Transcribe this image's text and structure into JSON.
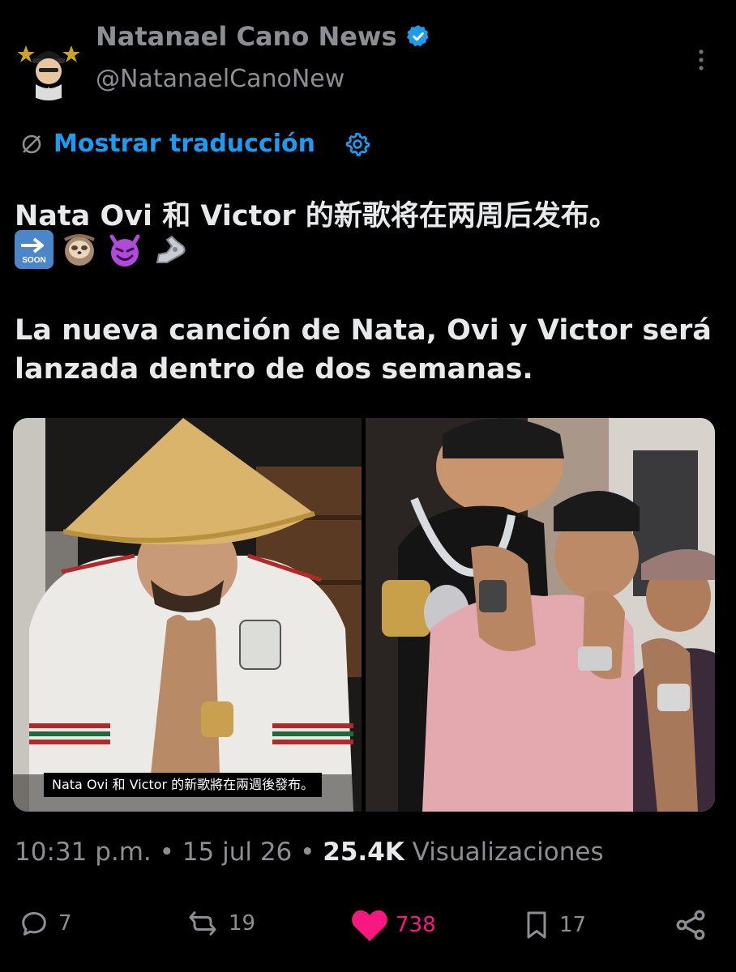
{
  "author": {
    "name": "Natanael Cano News",
    "handle": "@NatanaelCanoNew",
    "verified": true
  },
  "translate": {
    "label": "Mostrar traducción"
  },
  "tweet": {
    "line_zh": "Nata Ovi 和 Victor 的新歌将在两周后发布。",
    "emojis": [
      "soon-arrow",
      "sloth",
      "smiling-devil",
      "mechanical-arm"
    ],
    "line_es_1": "La nueva canción de Nata, Ovi y Victor será",
    "line_es_2": "lanzada dentro de dos semanas.",
    "image_caption": "Nata Ovi 和 Victor 的新歌將在兩週後發布。"
  },
  "meta": {
    "time": "10:31 p.m.",
    "sep": "•",
    "date": "15 jul 26",
    "views_count": "25.4K",
    "views_label": "Visualizaciones"
  },
  "actions": {
    "replies": "7",
    "reposts": "19",
    "likes": "738",
    "bookmarks": "17"
  },
  "colors": {
    "accent": "#1d9bf0",
    "like": "#f91880",
    "muted": "#8b8f94",
    "background": "#000000"
  }
}
